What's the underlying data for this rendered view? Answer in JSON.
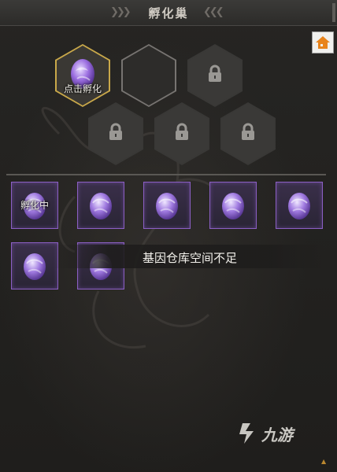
{
  "header": {
    "title": "孵化巢",
    "left_chevrons": "❯❯❯",
    "right_chevrons": "❮❮❮"
  },
  "home_button": {
    "icon": "home-icon",
    "color": "#e8841c"
  },
  "nests": [
    {
      "state": "egg",
      "label": "点击孵化"
    },
    {
      "state": "empty",
      "label": ""
    },
    {
      "state": "locked",
      "label": ""
    },
    {
      "state": "locked",
      "label": ""
    },
    {
      "state": "locked",
      "label": ""
    },
    {
      "state": "locked",
      "label": ""
    }
  ],
  "storage_row1": [
    {
      "label": "孵化中"
    },
    {
      "label": ""
    },
    {
      "label": ""
    },
    {
      "label": ""
    },
    {
      "label": ""
    }
  ],
  "storage_row2": [
    {
      "label": ""
    },
    {
      "label": ""
    }
  ],
  "toast": {
    "text": "基因仓库空间不足"
  },
  "watermark": {
    "text": "九游"
  },
  "colors": {
    "accent_gold": "#c9a84a",
    "egg_purple": "#8b5fc4",
    "home_orange": "#e8841c"
  }
}
